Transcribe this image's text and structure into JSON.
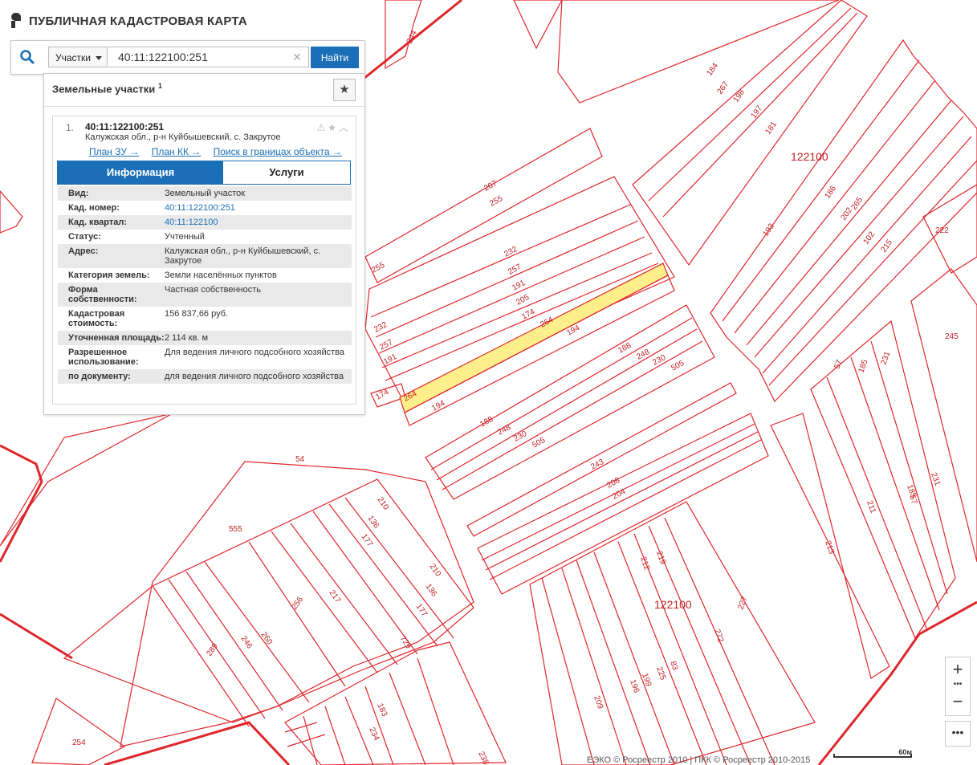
{
  "app": {
    "title": "ПУБЛИЧНАЯ КАДАСТРОВАЯ КАРТА"
  },
  "search": {
    "type_label": "Участки",
    "query": "40:11:122100:251",
    "clear_glyph": "✕",
    "find_label": "Найти"
  },
  "results": {
    "title": "Земельные участки",
    "count": "1",
    "favorite_glyph": "★",
    "item": {
      "index": "1.",
      "cad_number": "40:11:122100:251",
      "address": "Калужская обл., р-н Куйбышевский, с. Закрутое",
      "tool_glyphs": "⚠★︿",
      "links": [
        "План ЗУ →",
        "План КК →",
        "Поиск в границах объекта →"
      ],
      "tabs": {
        "info": "Информация",
        "services": "Услуги"
      },
      "fields": [
        {
          "key": "Вид:",
          "value": "Земельный участок",
          "link": false
        },
        {
          "key": "Кад. номер:",
          "value": "40:11:122100:251",
          "link": true
        },
        {
          "key": "Кад. квартал:",
          "value": "40:11:122100",
          "link": true
        },
        {
          "key": "Статус:",
          "value": "Учтенный",
          "link": false
        },
        {
          "key": "Адрес:",
          "value": "Калужская обл., р-н Куйбышевский, с. Закрутое",
          "link": false
        },
        {
          "key": "Категория земель:",
          "value": "Земли населённых пунктов",
          "link": false
        },
        {
          "key": "Форма собственности:",
          "value": "Частная собственность",
          "link": false
        },
        {
          "key": "Кадастровая стоимость:",
          "value": "156 837,66 руб.",
          "link": false
        },
        {
          "key": "Уточненная площадь:",
          "value": "2 114 кв. м",
          "link": false
        },
        {
          "key": "Разрешенное использование:",
          "value": "Для ведения личного подсобного хозяйства",
          "link": false
        },
        {
          "key": "по документу:",
          "value": "для ведения личного подсобного хозяйства",
          "link": false
        }
      ]
    }
  },
  "map": {
    "quarter_labels": [
      "122100",
      "122100"
    ],
    "parcel_labels": [
      "244",
      "207",
      "255",
      "255",
      "232",
      "257",
      "191",
      "205",
      "174",
      "264",
      "194",
      "232",
      "257",
      "191",
      "174",
      "264",
      "194",
      "188",
      "248",
      "230",
      "505",
      "188",
      "248",
      "230",
      "505",
      "243",
      "208",
      "204",
      "54",
      "555",
      "210",
      "136",
      "177",
      "210",
      "136",
      "177",
      "217",
      "256",
      "260",
      "246",
      "289",
      "729",
      "183",
      "234",
      "238",
      "254",
      "184",
      "267",
      "198",
      "197",
      "181",
      "193",
      "186",
      "202",
      "265",
      "102",
      "215",
      "222",
      "245",
      "57",
      "185",
      "231",
      "57",
      "211",
      "185",
      "231",
      "213",
      "212",
      "219",
      "227",
      "272",
      "83",
      "225",
      "199",
      "196",
      "209"
    ],
    "colors": {
      "parcel": "#e0262b",
      "selected": "#ffef8a",
      "accent": "#1a6fb6"
    }
  },
  "footer": {
    "attribution": "ЕЭКО © Росреестр 2010 | ПКК © Росреестр 2010-2015",
    "scale_label": "60м"
  },
  "controls": {
    "zoom_in": "+",
    "zoom_dots": "•••",
    "zoom_out": "−",
    "more": "•••"
  }
}
